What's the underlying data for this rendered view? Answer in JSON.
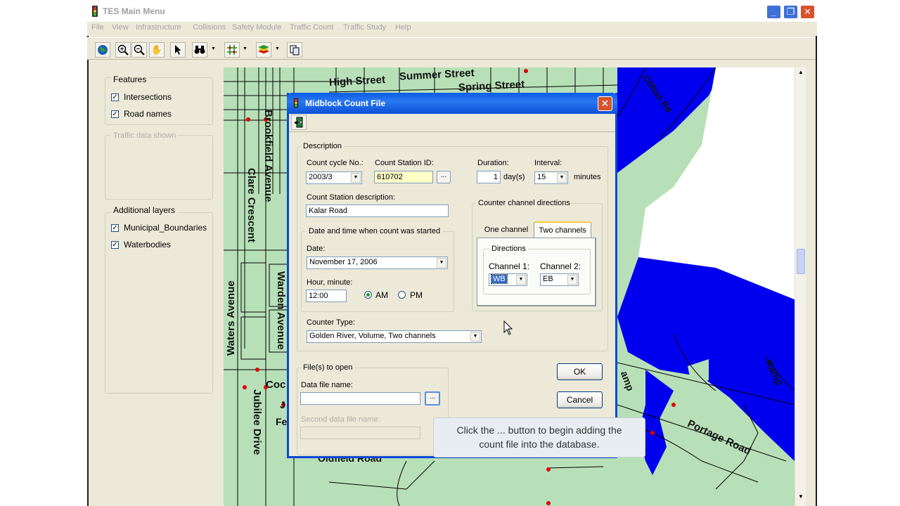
{
  "main_window": {
    "title": "TES Main Menu",
    "menu": [
      "File",
      "View",
      "Infrastructure",
      "Collisions",
      "Safety Module",
      "Traffic Count",
      "Traffic Study",
      "Help"
    ],
    "toolbar": [
      "globe-icon",
      "zoom-in-icon",
      "zoom-out-icon",
      "pan-hand-icon",
      "select-arrow-icon",
      "binoculars-icon",
      "grid-icon",
      "layers-icon",
      "copy-icon"
    ]
  },
  "left_panel": {
    "features_title": "Features",
    "features": [
      {
        "label": "Intersections",
        "checked": true
      },
      {
        "label": "Road names",
        "checked": true
      }
    ],
    "traffic_title": "Traffic data shown",
    "layers_title": "Additional layers",
    "layers": [
      {
        "label": "Municipal_Boundaries",
        "checked": true
      },
      {
        "label": "Waterbodies",
        "checked": true
      }
    ]
  },
  "map": {
    "roads": [
      "High Street",
      "Summer Street",
      "Spring Street",
      "Clifton Rd",
      "Brookfield Avenue",
      "Clare Crescent",
      "Waters Avenue",
      "Warden Avenue",
      "Jubilee Drive",
      "Oldfield Road",
      "Portage Road",
      "Coc",
      "J",
      "Fe",
      "amp",
      "Ramp"
    ],
    "water_color": "#0000ff",
    "land_color": "#b8e0b8"
  },
  "dialog": {
    "title": "Midblock Count File",
    "description_title": "Description",
    "count_cycle_label": "Count cycle No.:",
    "count_cycle_value": "2003/3",
    "station_id_label": "Count Station ID:",
    "station_id_value": "610702",
    "browse_label": "...",
    "duration_label": "Duration:",
    "duration_value": "1",
    "duration_unit": "day(s)",
    "interval_label": "Interval:",
    "interval_value": "15",
    "interval_unit": "minutes",
    "station_desc_label": "Count Station description:",
    "station_desc_value": "Kalar Road",
    "date_group_title": "Date and time when count was started",
    "date_label": "Date:",
    "date_value": "November 17, 2006",
    "hour_label": "Hour, minute:",
    "hour_value": "12:00",
    "am_label": "AM",
    "pm_label": "PM",
    "am_selected": true,
    "channel_group_title": "Counter channel directions",
    "tab_one": "One channel",
    "tab_two": "Two channels",
    "directions_title": "Directions",
    "channel1_label": "Channel 1:",
    "channel1_value": "WB",
    "channel2_label": "Channel 2:",
    "channel2_value": "EB",
    "counter_type_label": "Counter Type:",
    "counter_type_value": "Golden River, Volume, Two channels",
    "files_title": "File(s) to open",
    "data_file_label": "Data file name:",
    "data_file_value": "",
    "second_file_label": "Second data file name:",
    "second_file_value": "",
    "ok_label": "OK",
    "cancel_label": "Cancel"
  },
  "tooltip": {
    "line1": "Click the ... button to begin adding the",
    "line2": "count file into the database."
  }
}
